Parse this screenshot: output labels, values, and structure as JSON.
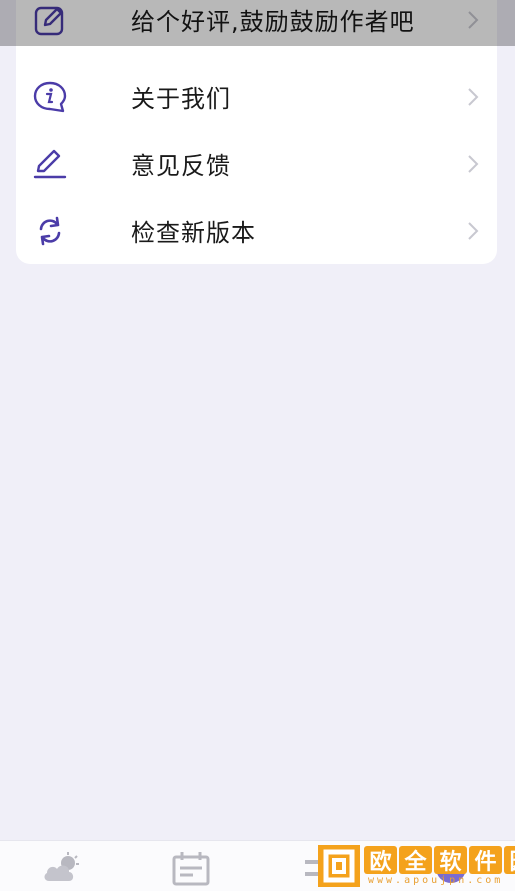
{
  "menu": {
    "items": [
      {
        "label": "给个好评,鼓励鼓励作者吧",
        "icon": "edit-square-icon"
      },
      {
        "label": "关于我们",
        "icon": "info-bubble-icon"
      },
      {
        "label": "意见反馈",
        "icon": "pen-icon"
      },
      {
        "label": "检查新版本",
        "icon": "refresh-icon"
      }
    ]
  },
  "tabbar": {
    "tabs": [
      {
        "icon": "cloud-sun-icon"
      },
      {
        "icon": "calendar-icon"
      },
      {
        "icon": "tools-icon"
      },
      {
        "icon": "profile-icon"
      }
    ]
  },
  "watermark": {
    "chars": [
      "欧",
      "全",
      "软",
      "件",
      "园"
    ],
    "url": "www.apoujpn.com"
  },
  "colors": {
    "accent": "#4b3ca8",
    "background": "#f0eff8",
    "card": "#ffffff",
    "chevron": "#c8c8d0"
  }
}
